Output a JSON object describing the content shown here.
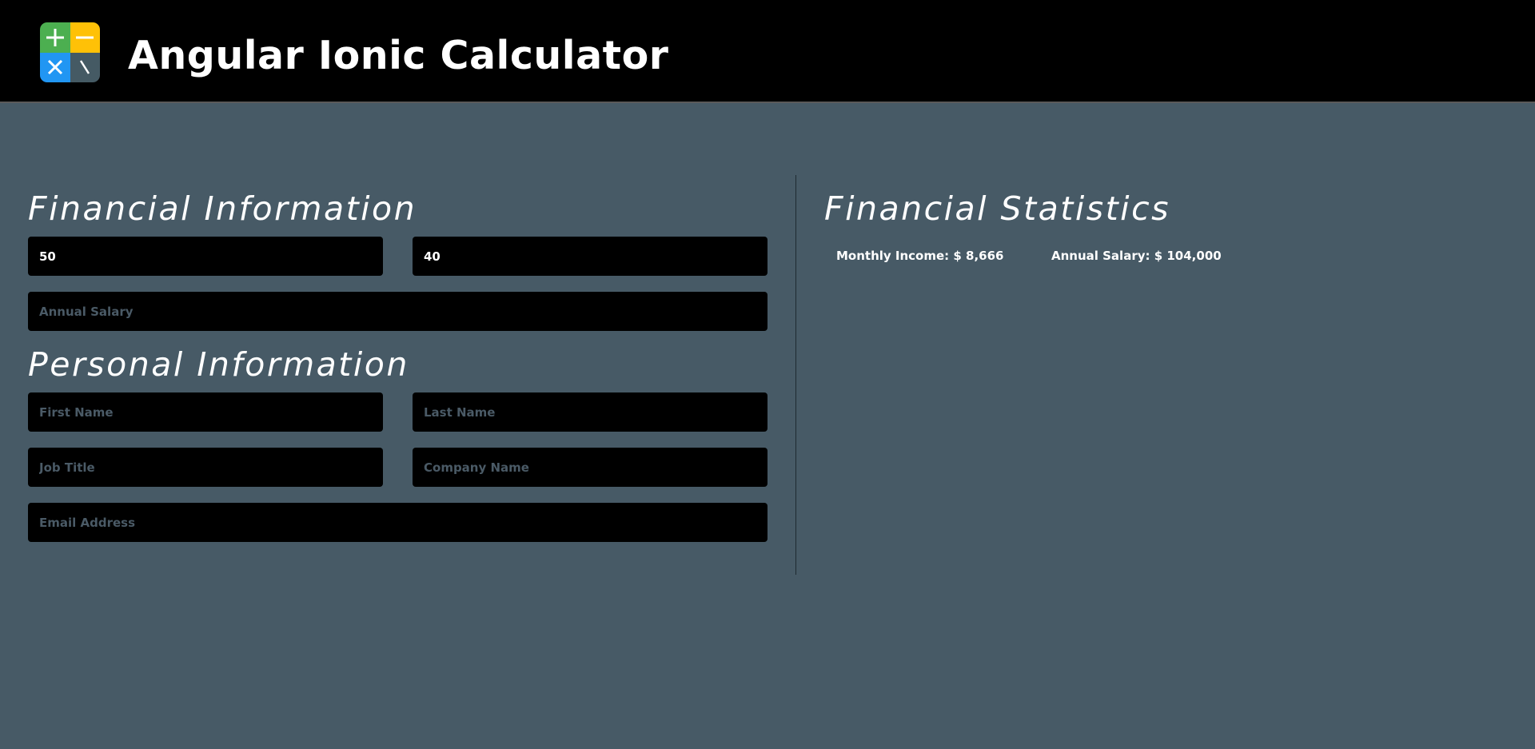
{
  "header": {
    "title": "Angular Ionic Calculator",
    "logo": {
      "icon": "calculator-logo-icon",
      "colors": {
        "plus": "#4caf50",
        "minus": "#ffc107",
        "times": "#2196f3",
        "divide": "#455a64"
      }
    }
  },
  "financial": {
    "heading": "Financial Information",
    "rate": {
      "value": "50",
      "placeholder": ""
    },
    "hours": {
      "value": "40",
      "placeholder": ""
    },
    "annual_salary": {
      "value": "",
      "placeholder": "Annual Salary"
    }
  },
  "personal": {
    "heading": "Personal Information",
    "first_name": {
      "value": "",
      "placeholder": "First Name"
    },
    "last_name": {
      "value": "",
      "placeholder": "Last Name"
    },
    "job_title": {
      "value": "",
      "placeholder": "Job Title"
    },
    "company_name": {
      "value": "",
      "placeholder": "Company Name"
    },
    "email": {
      "value": "",
      "placeholder": "Email Address"
    }
  },
  "statistics": {
    "heading": "Financial Statistics",
    "monthly_income": "Monthly Income: $ 8,666",
    "annual_salary": "Annual Salary: $ 104,000"
  },
  "colors": {
    "background": "#475a66",
    "header_bg": "#000000",
    "input_bg": "#000000",
    "placeholder": "#4a5a66",
    "text": "#ffffff"
  }
}
